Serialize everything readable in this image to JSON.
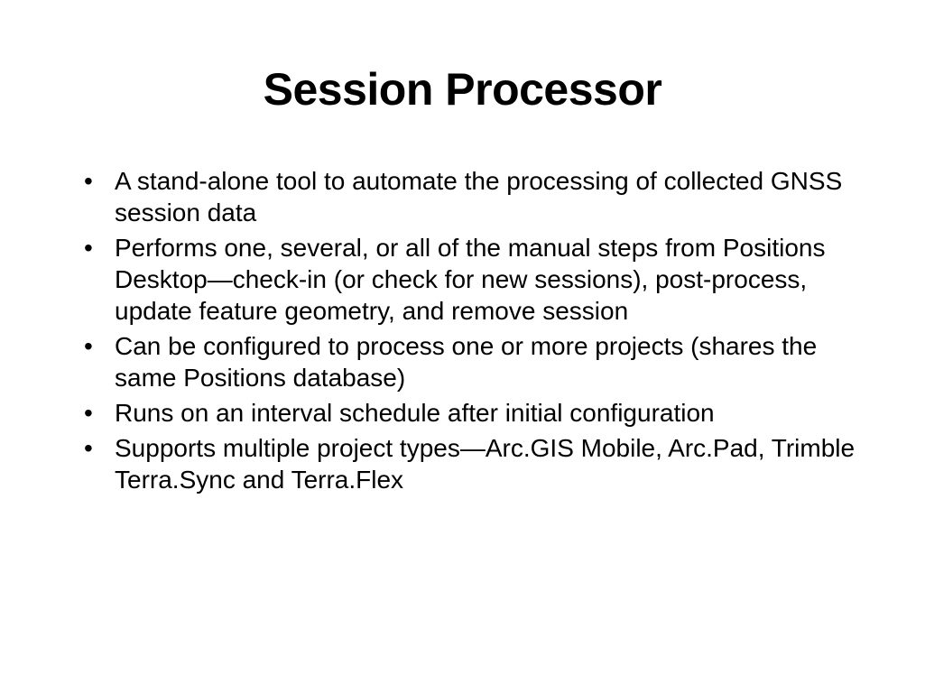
{
  "slide": {
    "title": "Session Processor",
    "bullets": [
      "A stand-alone tool to automate the processing of collected GNSS session data",
      "Performs one, several, or all of the manual steps from Positions Desktop—check-in (or check for new sessions), post-process, update feature geometry, and remove session",
      "Can be configured to process one or more projects (shares the same Positions database)",
      "Runs on an interval schedule after initial configuration",
      "Supports multiple project types—Arc.GIS Mobile, Arc.Pad, Trimble Terra.Sync and Terra.Flex"
    ]
  }
}
